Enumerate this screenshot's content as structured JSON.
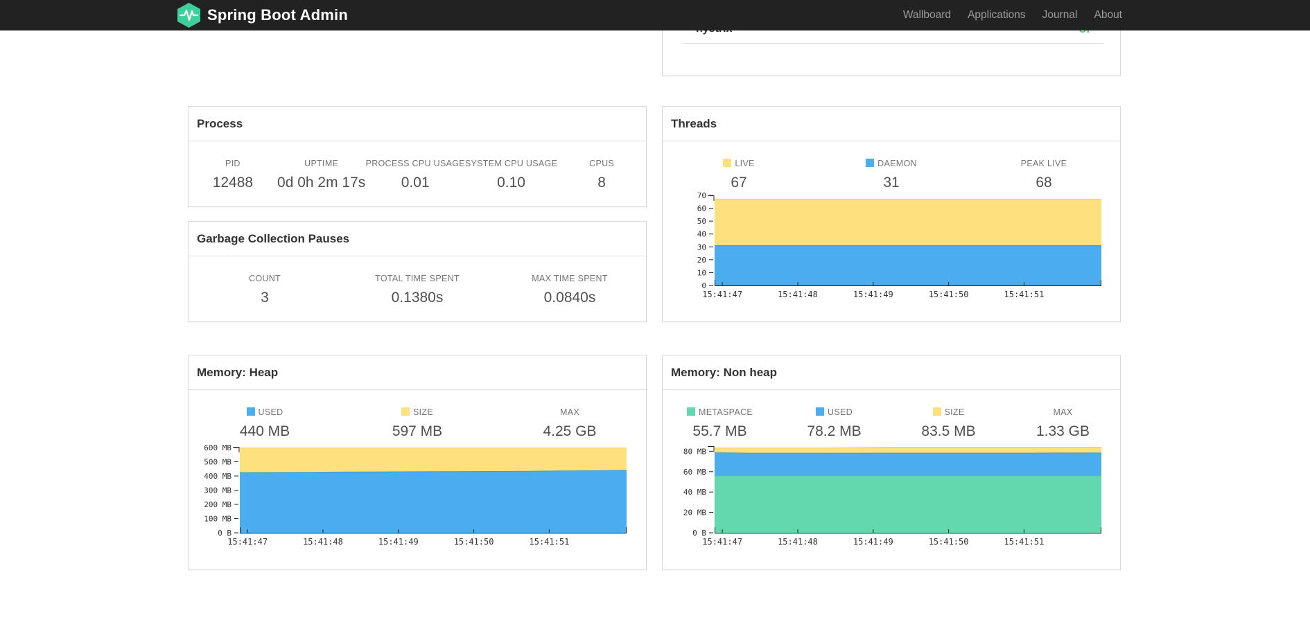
{
  "navbar": {
    "brand": "Spring Boot Admin",
    "logo_color": "#3ecf9d",
    "bg_color": "#222222",
    "link_color": "#9d9d9d",
    "items": [
      {
        "label": "Wallboard"
      },
      {
        "label": "Applications"
      },
      {
        "label": "Journal"
      },
      {
        "label": "About"
      }
    ]
  },
  "service": {
    "name": "hystrix",
    "status": "UP",
    "status_color": "#3fd46b"
  },
  "process": {
    "title": "Process",
    "metrics": [
      {
        "label": "PID",
        "value": "12488"
      },
      {
        "label": "UPTIME",
        "value": "0d 0h 2m 17s"
      },
      {
        "label": "PROCESS CPU USAGE",
        "value": "0.01"
      },
      {
        "label": "SYSTEM CPU USAGE",
        "value": "0.10"
      },
      {
        "label": "CPUS",
        "value": "8"
      }
    ]
  },
  "gc": {
    "title": "Garbage Collection Pauses",
    "metrics": [
      {
        "label": "COUNT",
        "value": "3"
      },
      {
        "label": "TOTAL TIME SPENT",
        "value": "0.1380s"
      },
      {
        "label": "MAX TIME SPENT",
        "value": "0.0840s"
      }
    ]
  },
  "threads": {
    "title": "Threads",
    "legend": [
      {
        "label": "LIVE",
        "value": "67",
        "swatch": "#fde17e"
      },
      {
        "label": "DAEMON",
        "value": "31",
        "swatch": "#4badee"
      },
      {
        "label": "PEAK LIVE",
        "value": "68",
        "swatch": null
      }
    ]
  },
  "heap": {
    "title": "Memory: Heap",
    "legend": [
      {
        "label": "USED",
        "value": "440 MB",
        "swatch": "#4badee"
      },
      {
        "label": "SIZE",
        "value": "597 MB",
        "swatch": "#fde17e"
      },
      {
        "label": "MAX",
        "value": "4.25 GB",
        "swatch": null
      }
    ]
  },
  "nonheap": {
    "title": "Memory: Non heap",
    "legend": [
      {
        "label": "METASPACE",
        "value": "55.7 MB",
        "swatch": "#63d8af"
      },
      {
        "label": "USED",
        "value": "78.2 MB",
        "swatch": "#4badee"
      },
      {
        "label": "SIZE",
        "value": "83.5 MB",
        "swatch": "#fde17e"
      },
      {
        "label": "MAX",
        "value": "1.33 GB",
        "swatch": null
      }
    ]
  },
  "chart_data": [
    {
      "name": "threads",
      "type": "area",
      "title": "Threads",
      "stacking": "absolute-tops",
      "ylim": [
        0,
        70
      ],
      "yticks": [
        {
          "v": 0,
          "label": "0"
        },
        {
          "v": 10,
          "label": "10"
        },
        {
          "v": 20,
          "label": "20"
        },
        {
          "v": 30,
          "label": "30"
        },
        {
          "v": 40,
          "label": "40"
        },
        {
          "v": 50,
          "label": "50"
        },
        {
          "v": 60,
          "label": "60"
        },
        {
          "v": 70,
          "label": "70"
        }
      ],
      "x_labels": [
        "15:41:47",
        "15:41:48",
        "15:41:49",
        "15:41:50",
        "15:41:51"
      ],
      "x_fractions": [
        0.02,
        0.215,
        0.41,
        0.605,
        0.8
      ],
      "series": [
        {
          "name": "LIVE",
          "color": "#fde17e",
          "line": "#ecca67",
          "values": [
            67,
            67,
            67,
            67,
            67,
            67,
            67,
            67,
            67,
            67,
            67,
            67
          ]
        },
        {
          "name": "DAEMON",
          "color": "#4badee",
          "line": "#3b9bd6",
          "values": [
            31,
            31,
            31,
            31,
            31,
            31,
            31,
            31,
            31,
            31,
            31,
            31
          ]
        }
      ]
    },
    {
      "name": "heap",
      "type": "area",
      "title": "Memory: Heap",
      "stacking": "absolute-tops",
      "ylim": [
        0,
        605
      ],
      "yticks": [
        {
          "v": 0,
          "label": "0 B"
        },
        {
          "v": 100,
          "label": "100 MB"
        },
        {
          "v": 200,
          "label": "200 MB"
        },
        {
          "v": 300,
          "label": "300 MB"
        },
        {
          "v": 400,
          "label": "400 MB"
        },
        {
          "v": 500,
          "label": "500 MB"
        },
        {
          "v": 600,
          "label": "600 MB"
        }
      ],
      "x_labels": [
        "15:41:47",
        "15:41:48",
        "15:41:49",
        "15:41:50",
        "15:41:51"
      ],
      "x_fractions": [
        0.02,
        0.215,
        0.41,
        0.605,
        0.8
      ],
      "series": [
        {
          "name": "SIZE",
          "color": "#fde17e",
          "line": "#ecca67",
          "values": [
            597,
            597,
            597,
            597,
            597,
            597,
            597,
            597,
            597,
            597,
            597,
            597
          ]
        },
        {
          "name": "USED",
          "color": "#4badee",
          "line": "#3b9bd6",
          "values": [
            424,
            425,
            426,
            428,
            429,
            430,
            431,
            432,
            433,
            435,
            437,
            440
          ]
        }
      ]
    },
    {
      "name": "nonheap",
      "type": "area",
      "title": "Memory: Non heap",
      "stacking": "absolute-tops",
      "ylim": [
        0,
        85
      ],
      "yticks": [
        {
          "v": 0,
          "label": "0 B"
        },
        {
          "v": 20,
          "label": "20 MB"
        },
        {
          "v": 40,
          "label": "40 MB"
        },
        {
          "v": 60,
          "label": "60 MB"
        },
        {
          "v": 80,
          "label": "80 MB"
        }
      ],
      "x_labels": [
        "15:41:47",
        "15:41:48",
        "15:41:49",
        "15:41:50",
        "15:41:51"
      ],
      "x_fractions": [
        0.02,
        0.215,
        0.41,
        0.605,
        0.8
      ],
      "series": [
        {
          "name": "SIZE",
          "color": "#fde17e",
          "line": "#ecca67",
          "values": [
            83.2,
            83.2,
            83.2,
            83.2,
            83.6,
            84,
            84,
            84,
            84,
            84,
            84,
            84
          ]
        },
        {
          "name": "USED",
          "color": "#4badee",
          "line": "#3b9bd6",
          "values": [
            78.6,
            78.1,
            78.1,
            78.1,
            78.1,
            78.2,
            78.2,
            78.2,
            78.2,
            78.2,
            78.4,
            78.4
          ]
        },
        {
          "name": "METASPACE",
          "color": "#63d8af",
          "line": "#52c79e",
          "values": [
            55.8,
            55.8,
            55.8,
            55.8,
            55.8,
            55.8,
            55.8,
            55.8,
            55.8,
            55.8,
            55.8,
            55.8
          ]
        }
      ]
    }
  ]
}
